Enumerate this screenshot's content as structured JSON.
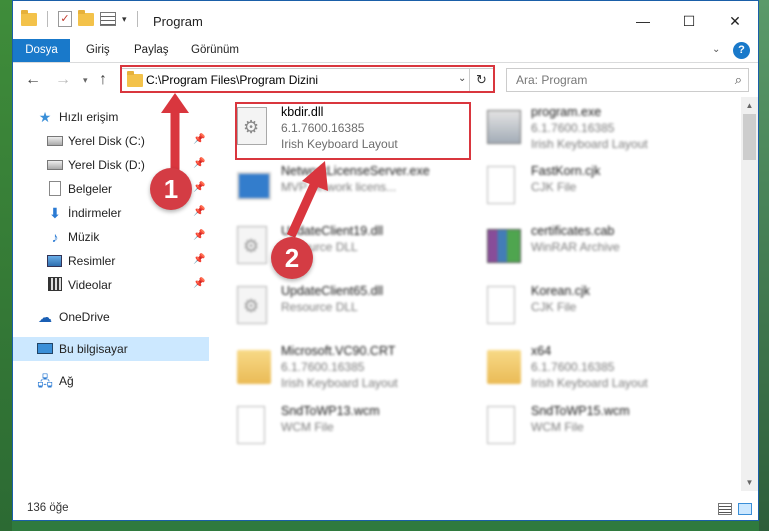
{
  "window": {
    "title": "Program",
    "controls": {
      "minimize": "—",
      "maximize": "☐",
      "close": "✕"
    }
  },
  "ribbon": {
    "file_tab": "Dosya",
    "tabs": [
      "Giriş",
      "Paylaş",
      "Görünüm"
    ],
    "help": "?"
  },
  "navigation": {
    "address_path": "C:\\Program Files\\Program Dizini",
    "search_placeholder": "Ara: Program"
  },
  "sidebar": {
    "items": [
      {
        "label": "Hızlı erişim",
        "icon": "star-icon",
        "pinned": false
      },
      {
        "label": "Yerel Disk (C:)",
        "icon": "drive-icon",
        "pinned": true
      },
      {
        "label": "Yerel Disk (D:)",
        "icon": "drive-icon",
        "pinned": true
      },
      {
        "label": "Belgeler",
        "icon": "documents-icon",
        "pinned": true
      },
      {
        "label": "İndirmeler",
        "icon": "download-icon",
        "pinned": true
      },
      {
        "label": "Müzik",
        "icon": "music-icon",
        "pinned": true
      },
      {
        "label": "Resimler",
        "icon": "pictures-icon",
        "pinned": true
      },
      {
        "label": "Videolar",
        "icon": "videos-icon",
        "pinned": true
      },
      {
        "label": "OneDrive",
        "icon": "cloud-icon",
        "pinned": false
      },
      {
        "label": "Bu bilgisayar",
        "icon": "computer-icon",
        "pinned": false,
        "selected": true
      },
      {
        "label": "Ağ",
        "icon": "network-icon",
        "pinned": false
      }
    ]
  },
  "files": [
    {
      "name": "kbdir.dll",
      "line2": "6.1.7600.16385",
      "line3": "Irish Keyboard Layout",
      "icon": "dll-gear-icon",
      "highlighted": true
    },
    {
      "name": "program.exe",
      "line2": "6.1.7600.16385",
      "line3": "Irish Keyboard Layout",
      "icon": "exe-icon"
    },
    {
      "name": "NetworkLicenseServer.exe",
      "line2": "MVP network licens...",
      "line3": "",
      "icon": "app-icon"
    },
    {
      "name": "FastKorn.cjk",
      "line2": "CJK File",
      "line3": "",
      "icon": "blank-file-icon"
    },
    {
      "name": "UpdateClient19.dll",
      "line2": "Resource DLL",
      "line3": "",
      "icon": "dll-gear-icon"
    },
    {
      "name": "certificates.cab",
      "line2": "WinRAR Archive",
      "line3": "",
      "icon": "archive-icon"
    },
    {
      "name": "UpdateClient65.dll",
      "line2": "Resource DLL",
      "line3": "",
      "icon": "dll-gear-icon"
    },
    {
      "name": "Korean.cjk",
      "line2": "CJK File",
      "line3": "",
      "icon": "blank-file-icon"
    },
    {
      "name": "Microsoft.VC90.CRT",
      "line2": "6.1.7600.16385",
      "line3": "Irish Keyboard Layout",
      "icon": "folder-icon"
    },
    {
      "name": "x64",
      "line2": "6.1.7600.16385",
      "line3": "Irish Keyboard Layout",
      "icon": "folder-icon"
    },
    {
      "name": "SndToWP13.wcm",
      "line2": "WCM File",
      "line3": "",
      "icon": "blank-file-icon"
    },
    {
      "name": "SndToWP15.wcm",
      "line2": "WCM File",
      "line3": "",
      "icon": "blank-file-icon"
    }
  ],
  "annotations": {
    "step1": "1",
    "step2": "2",
    "color": "#d9363e"
  },
  "status": {
    "count": "136 öğe"
  }
}
